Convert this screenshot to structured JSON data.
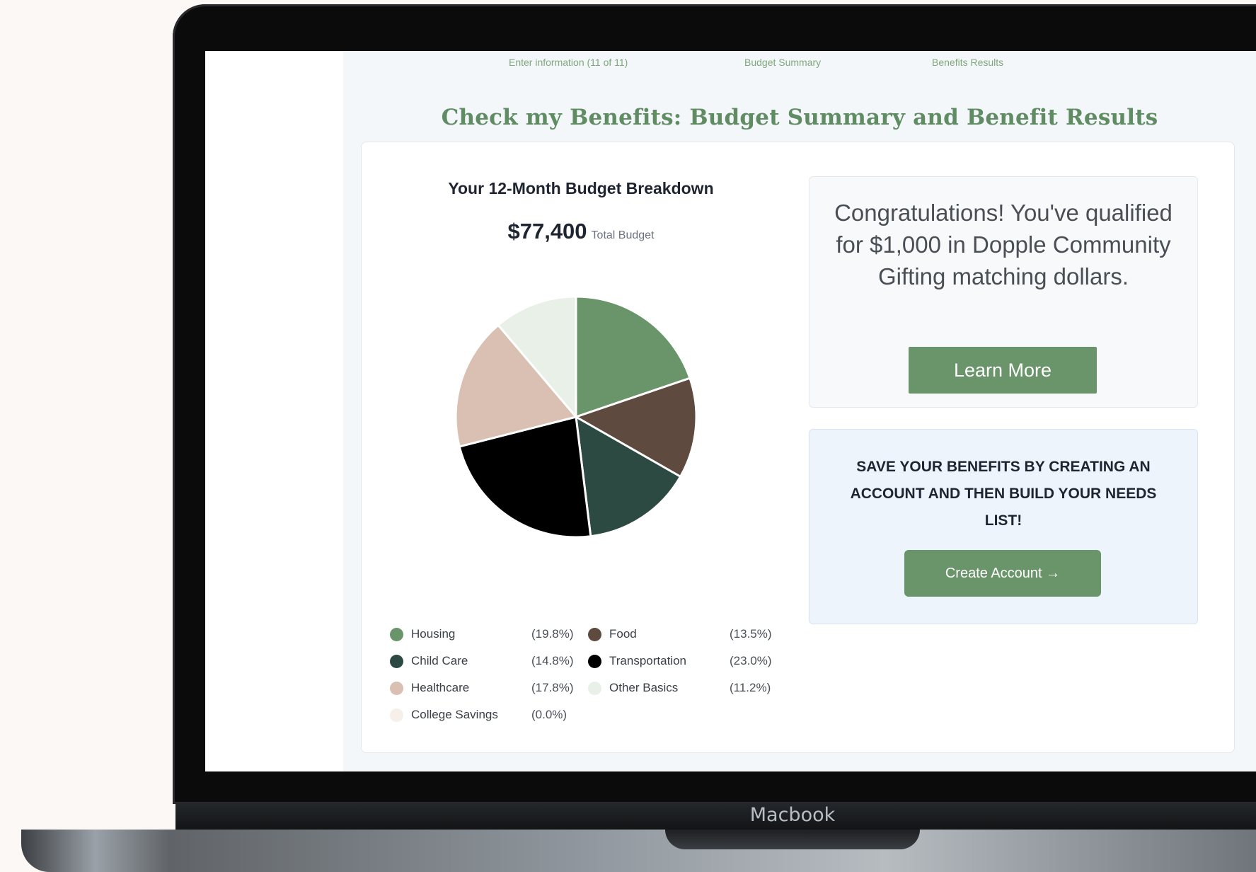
{
  "device": {
    "brand_label": "Macbook"
  },
  "steps": [
    {
      "label": "Enter information (11 of 11)"
    },
    {
      "label": "Budget Summary"
    },
    {
      "label": "Benefits Results"
    }
  ],
  "page": {
    "headline": "Check my Benefits: Budget Summary and Benefit Results"
  },
  "budget": {
    "chart_title": "Your 12-Month Budget Breakdown",
    "total_amount": "$77,400",
    "total_label": "Total Budget"
  },
  "chart_data": {
    "type": "pie",
    "title": "Your 12-Month Budget Breakdown",
    "total": 77400,
    "slices": [
      {
        "name": "Housing",
        "percent": 19.8,
        "label": "(19.8%)",
        "color": "#6a946a"
      },
      {
        "name": "Food",
        "percent": 13.5,
        "label": "(13.5%)",
        "color": "#5e4a3e"
      },
      {
        "name": "Child Care",
        "percent": 14.8,
        "label": "(14.8%)",
        "color": "#2c4a42"
      },
      {
        "name": "Transportation",
        "percent": 23.0,
        "label": "(23.0%)",
        "color": "#000000"
      },
      {
        "name": "Healthcare",
        "percent": 17.8,
        "label": "(17.8%)",
        "color": "#d9c0b2"
      },
      {
        "name": "Other Basics",
        "percent": 11.2,
        "label": "(11.2%)",
        "color": "#e8f0e8"
      },
      {
        "name": "College Savings",
        "percent": 0.0,
        "label": "(0.0%)",
        "color": "#f6efea"
      }
    ]
  },
  "congrats": {
    "message": "Congratulations! You've qualified for $1,000 in Dopple Community Gifting matching dollars.",
    "button_label": "Learn More"
  },
  "save": {
    "message": "Save your benefits by creating an account and then build your needs list!",
    "button_label": "Create Account →"
  }
}
